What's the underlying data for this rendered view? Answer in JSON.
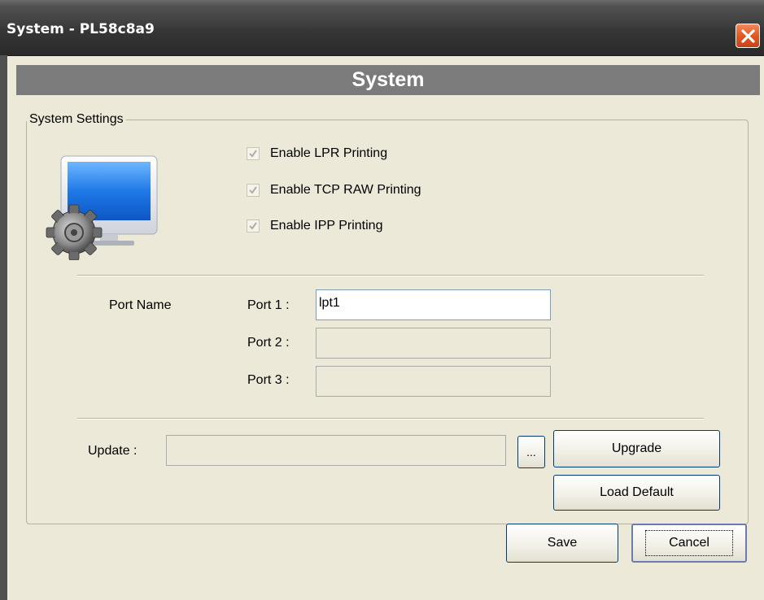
{
  "window": {
    "title": "System - PL58c8a9",
    "close_icon": "close-icon"
  },
  "header": {
    "title": "System"
  },
  "system_settings": {
    "legend": "System Settings",
    "icon": "monitor-gear-icon",
    "checkboxes": [
      {
        "label": "Enable LPR Printing",
        "checked": true,
        "disabled": true
      },
      {
        "label": "Enable TCP RAW Printing",
        "checked": true,
        "disabled": true
      },
      {
        "label": "Enable IPP Printing",
        "checked": true,
        "disabled": true
      }
    ],
    "port_name_label": "Port Name",
    "ports": [
      {
        "label": "Port 1 :",
        "value": "lpt1",
        "enabled": true
      },
      {
        "label": "Port 2 :",
        "value": "",
        "enabled": false
      },
      {
        "label": "Port 3 :",
        "value": "",
        "enabled": false
      }
    ],
    "update": {
      "label": "Update :",
      "value": "",
      "browse_label": "...",
      "upgrade_label": "Upgrade",
      "load_default_label": "Load Default"
    }
  },
  "footer": {
    "save_label": "Save",
    "cancel_label": "Cancel"
  },
  "colors": {
    "titlebar": "#3e3e3e",
    "header_bar": "#7b7b7b",
    "dialog_bg": "#ece9d8",
    "close_button": "#e15a23"
  }
}
